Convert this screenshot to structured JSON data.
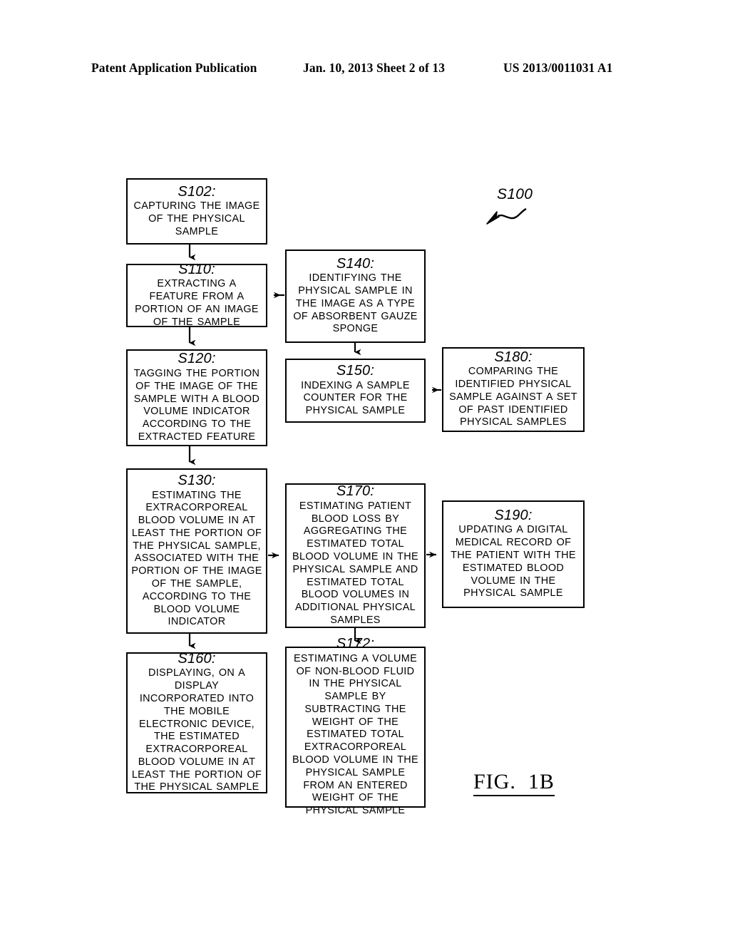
{
  "header": {
    "publication": "Patent Application Publication",
    "date_sheet": "Jan. 10, 2013  Sheet 2 of 13",
    "publication_number": "US 2013/0011031 A1"
  },
  "figure": {
    "caption": "FIG.  1B",
    "reference_label": "S100"
  },
  "flowchart": {
    "boxes": [
      {
        "id": "S102",
        "step_id": "S102:",
        "body": "CAPTURING THE IMAGE OF THE PHYSICAL SAMPLE"
      },
      {
        "id": "S110",
        "step_id": "S110:",
        "body": "EXTRACTING A FEATURE FROM A PORTION OF AN IMAGE OF THE SAMPLE"
      },
      {
        "id": "S120",
        "step_id": "S120:",
        "body": "TAGGING THE PORTION OF THE IMAGE OF THE SAMPLE WITH A BLOOD VOLUME INDICATOR ACCORDING TO THE EXTRACTED FEATURE"
      },
      {
        "id": "S130",
        "step_id": "S130:",
        "body": "ESTIMATING THE EXTRACORPOREAL BLOOD VOLUME IN AT LEAST THE PORTION OF THE PHYSICAL SAMPLE, ASSOCIATED WITH THE PORTION OF THE IMAGE OF THE SAMPLE, ACCORDING TO THE BLOOD VOLUME INDICATOR"
      },
      {
        "id": "S160",
        "step_id": "S160:",
        "body": "DISPLAYING, ON A DISPLAY INCORPORATED INTO THE MOBILE ELECTRONIC DEVICE, THE ESTIMATED EXTRACORPOREAL BLOOD VOLUME IN AT LEAST THE PORTION OF THE PHYSICAL SAMPLE"
      },
      {
        "id": "S140",
        "step_id": "S140:",
        "body": "IDENTIFYING THE PHYSICAL SAMPLE IN THE IMAGE AS A TYPE OF ABSORBENT GAUZE SPONGE"
      },
      {
        "id": "S150",
        "step_id": "S150:",
        "body": "INDEXING A SAMPLE COUNTER FOR THE PHYSICAL SAMPLE"
      },
      {
        "id": "S170",
        "step_id": "S170:",
        "body": "ESTIMATING PATIENT BLOOD LOSS BY AGGREGATING THE ESTIMATED TOTAL BLOOD VOLUME IN THE PHYSICAL SAMPLE AND ESTIMATED TOTAL BLOOD VOLUMES IN ADDITIONAL PHYSICAL SAMPLES"
      },
      {
        "id": "S172",
        "step_id": "S172:",
        "body": "ESTIMATING A VOLUME OF NON-BLOOD FLUID IN THE PHYSICAL SAMPLE BY SUBTRACTING THE WEIGHT OF THE ESTIMATED TOTAL EXTRACORPOREAL BLOOD VOLUME IN THE PHYSICAL SAMPLE FROM AN ENTERED WEIGHT OF THE PHYSICAL SAMPLE"
      },
      {
        "id": "S180",
        "step_id": "S180:",
        "body": "COMPARING THE IDENTIFIED PHYSICAL SAMPLE AGAINST A SET OF PAST IDENTIFIED PHYSICAL SAMPLES"
      },
      {
        "id": "S190",
        "step_id": "S190:",
        "body": "UPDATING A DIGITAL MEDICAL RECORD OF THE PATIENT WITH THE ESTIMATED BLOOD VOLUME IN THE PHYSICAL SAMPLE"
      }
    ],
    "connectors": [
      {
        "from": "S102",
        "to": "S110",
        "direction": "down"
      },
      {
        "from": "S110",
        "to": "S120",
        "direction": "down"
      },
      {
        "from": "S120",
        "to": "S130",
        "direction": "down"
      },
      {
        "from": "S130",
        "to": "S160",
        "direction": "down"
      },
      {
        "from": "S140",
        "to": "S110",
        "direction": "left"
      },
      {
        "from": "S140",
        "to": "S150",
        "direction": "down"
      },
      {
        "from": "S180",
        "to": "S150",
        "direction": "left"
      },
      {
        "from": "S130",
        "to": "S170",
        "direction": "right"
      },
      {
        "from": "S170",
        "to": "S190",
        "direction": "right"
      },
      {
        "from": "S170",
        "to": "S172",
        "direction": "down"
      }
    ]
  },
  "colors": {
    "ink": "#000000",
    "paper": "#ffffff"
  }
}
